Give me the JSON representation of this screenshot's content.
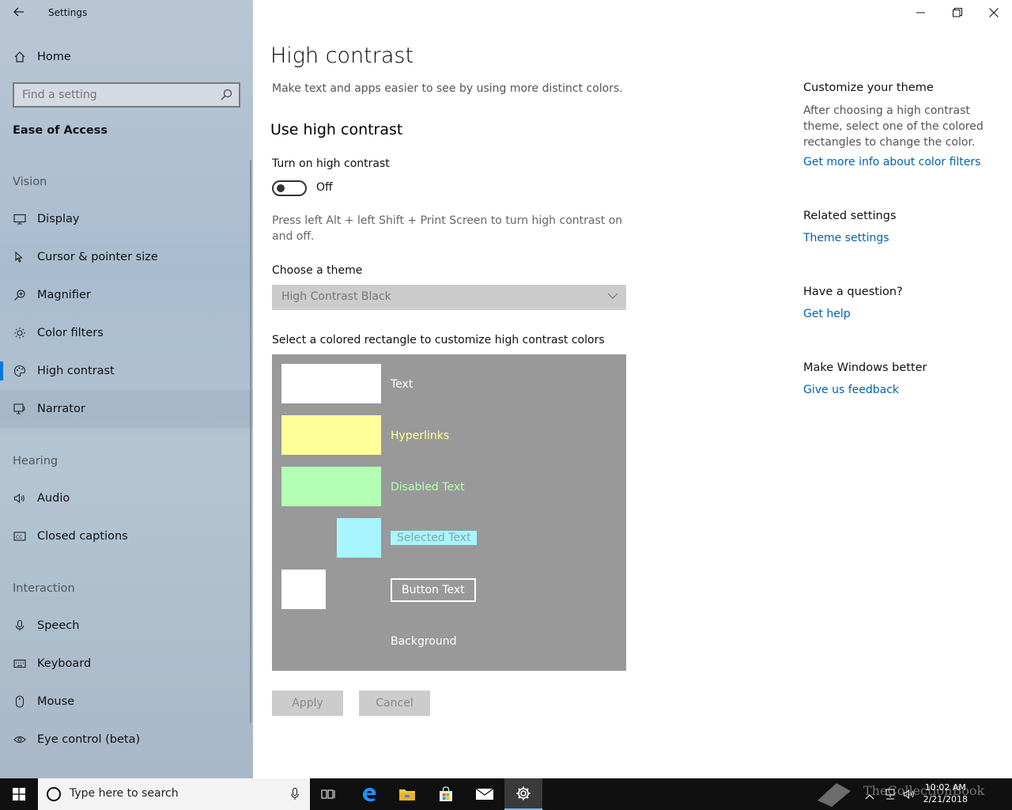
{
  "window": {
    "title": "Settings",
    "controls": [
      "minimize",
      "maximize",
      "close"
    ]
  },
  "sidebar": {
    "home_label": "Home",
    "search_placeholder": "Find a setting",
    "group_title": "Ease of Access",
    "sections": {
      "vision": "Vision",
      "hearing": "Hearing",
      "interaction": "Interaction"
    },
    "items": {
      "display": "Display",
      "cursor": "Cursor & pointer size",
      "magnifier": "Magnifier",
      "color_filters": "Color filters",
      "high_contrast": "High contrast",
      "narrator": "Narrator",
      "audio": "Audio",
      "closed_captions": "Closed captions",
      "speech": "Speech",
      "keyboard": "Keyboard",
      "mouse": "Mouse",
      "eye_control": "Eye control (beta)"
    },
    "selected": "high_contrast"
  },
  "main": {
    "title": "High contrast",
    "description": "Make text and apps easier to see by using more distinct colors.",
    "use_title": "Use high contrast",
    "toggle_label": "Turn on high contrast",
    "toggle_state": "Off",
    "hint": "Press left Alt + left Shift + Print Screen to turn high contrast on and off.",
    "theme_label": "Choose a theme",
    "theme_value": "High Contrast Black",
    "palette_label": "Select a colored rectangle to customize high contrast colors",
    "palette": {
      "background_color": "#999999",
      "text": {
        "label": "Text",
        "color": "#ffffff"
      },
      "hyperlinks": {
        "label": "Hyperlinks",
        "color": "#ffff99"
      },
      "disabled": {
        "label": "Disabled Text",
        "color": "#b3ffb3"
      },
      "selected": {
        "label": "Selected Text",
        "color": "#a6f5ff"
      },
      "button": {
        "label": "Button Text",
        "color": "#ffffff"
      },
      "background": {
        "label": "Background"
      }
    },
    "apply_label": "Apply",
    "cancel_label": "Cancel"
  },
  "right": {
    "customize_title": "Customize your theme",
    "customize_text": "After choosing a high contrast theme, select one of the colored rectangles to change the color.",
    "color_filters_link": "Get more info about color filters",
    "related_title": "Related settings",
    "theme_settings_link": "Theme settings",
    "question_title": "Have a question?",
    "help_link": "Get help",
    "better_title": "Make Windows better",
    "feedback_link": "Give us feedback"
  },
  "taskbar": {
    "search_placeholder": "Type here to search",
    "time": "10:02 AM",
    "date": "2/21/2018",
    "watermark": "TheCollectionBook"
  },
  "colors": {
    "accent": "#0078d7",
    "link": "#0063b1"
  }
}
